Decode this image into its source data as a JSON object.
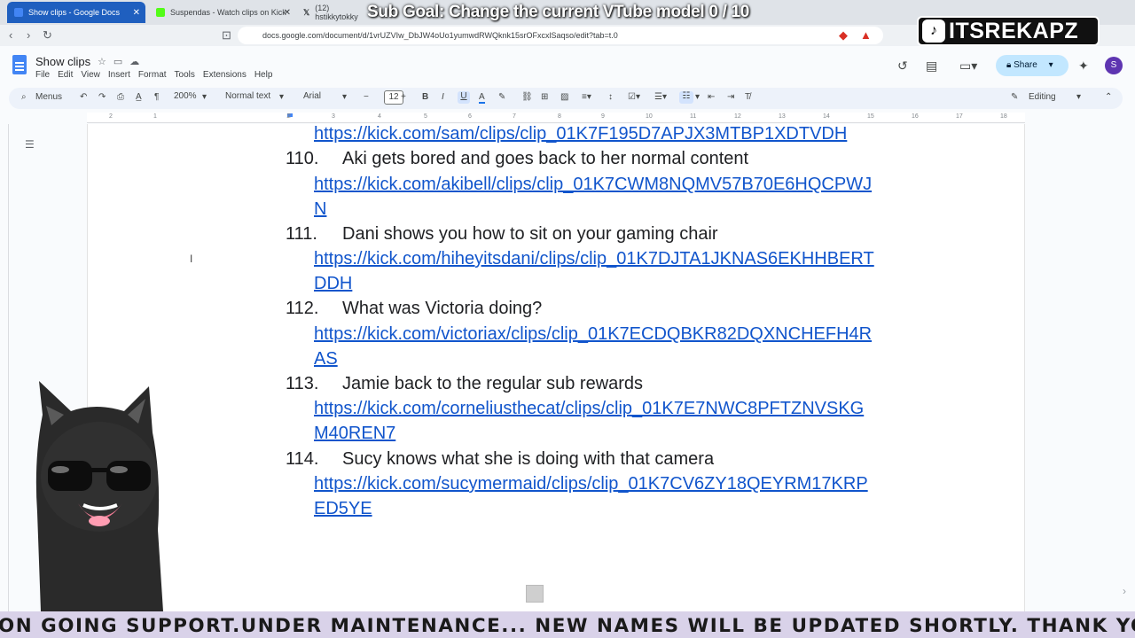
{
  "browser": {
    "tabs": [
      {
        "label": "Show clips - Google Docs",
        "active": true
      },
      {
        "label": "Suspendas - Watch clips on Kick",
        "active": false
      },
      {
        "label": "(12) hstikkytokky",
        "active": false
      }
    ],
    "url": "docs.google.com/document/d/1vrUZVIw_DbJW4oUo1yumwdRWQknk15srOFxcxlSaqso/edit?tab=t.0"
  },
  "overlay": {
    "sub_goal": "Sub Goal: Change the current VTube model  0 / 10",
    "streamer_name": "ITSREKAPZ",
    "ticker": "ON GOING SUPPORT.UNDER MAINTENANCE... NEW NAMES WILL BE UPDATED SHORTLY. THANK YOU FOR Y"
  },
  "docs": {
    "title": "Show clips",
    "menu": [
      "File",
      "Edit",
      "View",
      "Insert",
      "Format",
      "Tools",
      "Extensions",
      "Help"
    ],
    "share_label": "Share",
    "avatar_letter": "S",
    "toolbar": {
      "menus_label": "Menus",
      "zoom": "200%",
      "style": "Normal text",
      "font": "Arial",
      "font_size": "12",
      "mode": "Editing"
    },
    "ruler_labels": [
      "2",
      "1",
      "1",
      "2",
      "3",
      "4",
      "5",
      "6",
      "7",
      "8",
      "9",
      "10",
      "11",
      "12",
      "13",
      "14",
      "15",
      "16",
      "17",
      "18"
    ],
    "content": {
      "top_link": "https://kick.com/sam/clips/clip_01K7F195D7APJX3MTBP1XDTVDH",
      "items": [
        {
          "num": "110.",
          "text": "Aki gets bored and goes back to her normal content",
          "link_line1": "https://kick.com/akibell/clips/clip_01K7CWM8NQMV57B70E6HQCPWJ",
          "link_line2": "N"
        },
        {
          "num": "111.",
          "text": "Dani shows you how to sit on your gaming chair",
          "link_line1": "https://kick.com/hiheyitsdani/clips/clip_01K7DJTA1JKNAS6EKHHBERT",
          "link_line2": "DDH"
        },
        {
          "num": "112.",
          "text": "What was Victoria doing?",
          "link_line1": "https://kick.com/victoriax/clips/clip_01K7ECDQBKR82DQXNCHEFH4R",
          "link_line2": "AS"
        },
        {
          "num": "113.",
          "text": "Jamie back to the regular sub rewards",
          "link_line1": "https://kick.com/corneliusthecat/clips/clip_01K7E7NWC8PFTZNVSKG",
          "link_line2": "M40REN7"
        },
        {
          "num": "114.",
          "text": "Sucy knows what she is doing with that camera",
          "link_line1": "https://kick.com/sucymermaid/clips/clip_01K7CV6ZY18QEYRM17KRP",
          "link_line2": "ED5YE"
        }
      ]
    }
  }
}
